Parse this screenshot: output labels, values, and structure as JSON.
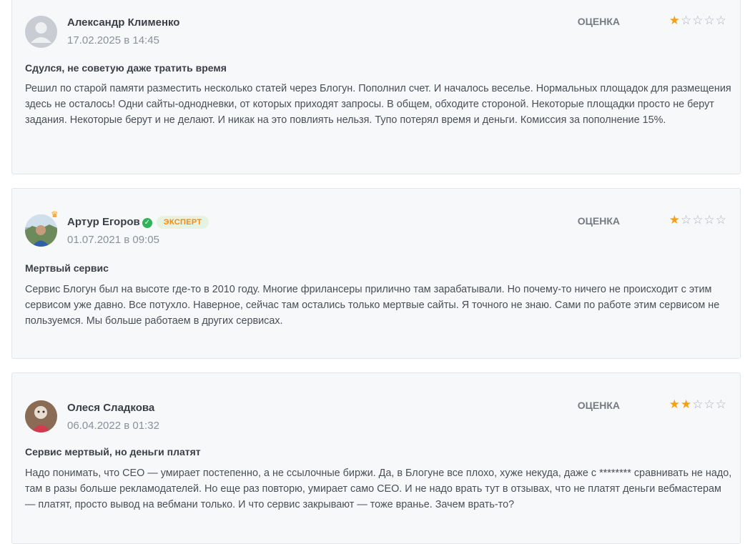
{
  "rating_label": "ОЦЕНКА",
  "colors": {
    "star_filled": "#f3a11a",
    "star_empty": "#a9aeb5",
    "badge_text": "#f08a1a",
    "badge_bg": "#e6f3e0",
    "verified": "#2fb45a"
  },
  "reviews": [
    {
      "author": "Александр Клименко",
      "date": "17.02.2025 в 14:45",
      "title": "Сдулся, не советую даже тратить время",
      "text": "Решил по старой памяти разместить несколько статей через Блогун. Пополнил счет. И началось веселье. Нормальных площадок для размещения здесь не осталось! Одни сайты-однодневки, от которых приходят запросы. В общем, обходите стороной. Некоторые площадки просто не берут задания. Некоторые берут и не делают. И никак на это повлиять нельзя. Тупо потерял время и деньги. Комиссия за пополнение 15%.",
      "rating": 1,
      "max_rating": 5,
      "avatar": "placeholder-user-icon"
    },
    {
      "author": "Артур Егоров",
      "verified_icon": "check-circle-icon",
      "badge": "ЭКСПЕРТ",
      "crown_icon": "crown-icon",
      "date": "01.07.2021 в 09:05",
      "title": "Мертвый сервис",
      "text": "Сервис Блогун был на высоте где-то в 2010 году. Многие фрилансеры прилично там зарабатывали. Но почему-то ничего не происходит с этим сервисом уже давно. Все потухло. Наверное, сейчас там остались только мертвые сайты. Я точного не знаю. Сами по работе этим сервисом не пользуемся. Мы больше работаем в других сервисах.",
      "rating": 1,
      "max_rating": 5,
      "avatar": "photo-avatar"
    },
    {
      "author": "Олеся Сладкова",
      "date": "06.04.2022 в 01:32",
      "title": "Сервис мертвый, но деньги платят",
      "text": "Надо понимать, что CEO — умирает постепенно, а не ссылочные биржи. Да, в Блогуне все плохо, хуже некуда, даже с ******** сравнивать не надо, там в разы больше рекламодателей. Но еще раз повторю, умирает само CEO. И не надо врать тут в отзывах, что не платят деньги вебмастерам — платят, просто вывод на вебмани только. И что сервис закрывают — тоже вранье. Зачем врать-то?",
      "rating": 2,
      "max_rating": 5,
      "avatar": "photo-avatar"
    }
  ]
}
